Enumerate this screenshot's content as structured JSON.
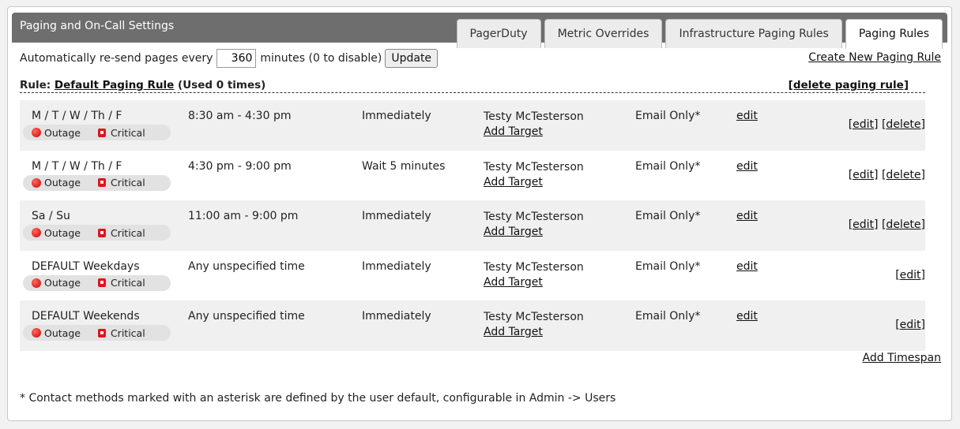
{
  "header": {
    "title": "Paging and On-Call Settings",
    "tabs": [
      {
        "label": "PagerDuty"
      },
      {
        "label": "Metric Overrides"
      },
      {
        "label": "Infrastructure Paging Rules"
      },
      {
        "label": "Paging Rules",
        "active": true
      }
    ]
  },
  "resend": {
    "label_before": "Automatically re-send pages every",
    "value": "360",
    "label_after": "minutes (0 to disable)",
    "update_label": "Update"
  },
  "create_rule_label": "Create New Paging Rule",
  "rule": {
    "prefix": "Rule:",
    "name": "Default Paging Rule",
    "usage": "(Used 0 times)",
    "delete_label": "[delete paging rule]"
  },
  "badges": {
    "outage": "Outage",
    "critical": "Critical"
  },
  "rows": [
    {
      "days": "M / T / W / Th / F",
      "time": "8:30 am - 4:30 pm",
      "delay": "Immediately",
      "target": "Testy McTesterson",
      "add_target": "Add Target",
      "method": "Email Only*",
      "edit": "edit",
      "edit_bracket": "[edit]",
      "delete_bracket": "[delete]"
    },
    {
      "days": "M / T / W / Th / F",
      "time": "4:30 pm - 9:00 pm",
      "delay": "Wait 5 minutes",
      "target": "Testy McTesterson",
      "add_target": "Add Target",
      "method": "Email Only*",
      "edit": "edit",
      "edit_bracket": "[edit]",
      "delete_bracket": "[delete]"
    },
    {
      "days": "Sa / Su",
      "time": "11:00 am - 9:00 pm",
      "delay": "Immediately",
      "target": "Testy McTesterson",
      "add_target": "Add Target",
      "method": "Email Only*",
      "edit": "edit",
      "edit_bracket": "[edit]",
      "delete_bracket": "[delete]"
    },
    {
      "days": "DEFAULT Weekdays",
      "time": "Any unspecified time",
      "delay": "Immediately",
      "target": "Testy McTesterson",
      "add_target": "Add Target",
      "method": "Email Only*",
      "edit": "edit",
      "edit_bracket": "[edit]"
    },
    {
      "days": "DEFAULT Weekends",
      "time": "Any unspecified time",
      "delay": "Immediately",
      "target": "Testy McTesterson",
      "add_target": "Add Target",
      "method": "Email Only*",
      "edit": "edit",
      "edit_bracket": "[edit]"
    }
  ],
  "add_timespan_label": "Add Timespan",
  "footnote": "* Contact methods marked with an asterisk are defined by the user default, configurable in Admin -> Users",
  "colors": {
    "header_bg": "#6e6e6e",
    "row_shade": "#f0f0f0",
    "outage_red": "#c8000a",
    "critical_red": "#e0141e"
  }
}
